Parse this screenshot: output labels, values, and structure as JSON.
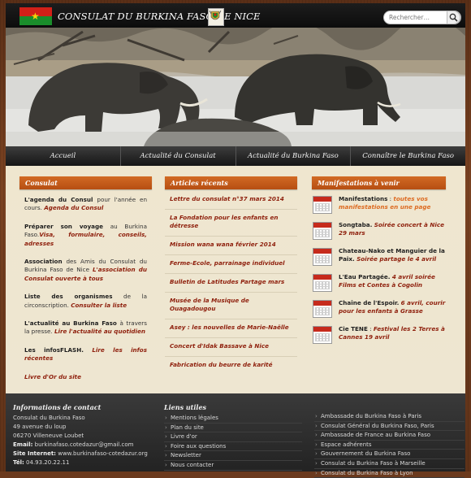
{
  "header": {
    "title": "Consulat du Burkina Faso de Nice",
    "search_placeholder": "Rechercher…"
  },
  "nav": {
    "items": [
      {
        "label": "Accueil"
      },
      {
        "label": "Actualité du Consulat"
      },
      {
        "label": "Actualité du Burkina Faso"
      },
      {
        "label": "Connaître le Burkina Faso"
      }
    ]
  },
  "consulat": {
    "title": "Consulat",
    "items": [
      {
        "lead": "L'agenda du Consul",
        "text": " pour l'année en cours. ",
        "link": "Agenda du Consul"
      },
      {
        "lead": "Préparer son voyage",
        "text": " au Burkina Faso.",
        "link": "Visa, formulaire, conseils, adresses"
      },
      {
        "lead": "Association",
        "text": " des Amis du Consulat du Burkina Faso de Nice ",
        "link": "L'association du Consulat ouverte à tous"
      },
      {
        "lead": "Liste des organismes",
        "text": " de la circonscription. ",
        "link": "Consulter la liste"
      },
      {
        "lead": "L'actualité au Burkina Faso",
        "text": " à travers la presse. ",
        "link": "Lire l'actualité au quotidien"
      },
      {
        "lead": "",
        "text": "Les infosFLASH. ",
        "link": "Lire les infos récentes"
      },
      {
        "lead": "",
        "text": "",
        "link": "Livre d'Or du site"
      }
    ]
  },
  "articles": {
    "title": "Articles récents",
    "items": [
      "Lettre du consulat n°37 mars 2014",
      "La Fondation pour les enfants en détresse",
      "Mission wana wana février 2014",
      "Ferme-Ecole, parrainage individuel",
      "Bulletin de Latitudes Partage mars",
      "Musée de la Musique de Ouagadougou",
      "Asey : les nouvelles de Marie-Naëlle",
      "Concert d'Idak Bassave à Nice",
      "Fabrication du beurre de karité"
    ]
  },
  "manifestations": {
    "title": "Manifestations à venir",
    "items": [
      {
        "lead": "Manifestations",
        "sep": " : ",
        "link": "toutes vos manifestations en une page",
        "orange": true
      },
      {
        "lead": "Songtaba.",
        "sep": " ",
        "link": "Soirée concert à Nice 29 mars",
        "orange": false
      },
      {
        "lead": "Chateau-Nako et Manguier de la Paix.",
        "sep": " ",
        "link": "Soirée partage le 4 avril",
        "orange": false
      },
      {
        "lead": "L'Eau Partagée.",
        "sep": " ",
        "link": "4 avril soirée Films et Contes à Cogolin",
        "orange": false
      },
      {
        "lead": "Chaîne de l'Espoir.",
        "sep": " ",
        "link": "6 avril, courir pour les enfants à Grasse",
        "orange": false
      },
      {
        "lead": "Cie TENE",
        "sep": " : ",
        "link": "Festival les 2 Terres à Cannes 19 avril",
        "orange": false
      }
    ]
  },
  "footer": {
    "contact_title": "Informations de contact",
    "contact": {
      "name": "Consulat du Burkina Faso",
      "address1": "49 avenue du loup",
      "address2": "06270 Villeneuve Loubet",
      "email_label": "Email:",
      "email": "burkinafaso.cotedazur@gmail.com",
      "site_label": "Site Internet:",
      "site": "www.burkinafaso-cotedazur.org",
      "tel_label": "Tél:",
      "tel": "04.93.20.22.11"
    },
    "links_title": "Liens utiles",
    "links": [
      "Mentions légales",
      "Plan du site",
      "Livre d'or",
      "Foire aux questions",
      "Newsletter",
      "Nous contacter"
    ],
    "external": [
      "Ambassade du Burkina Faso à Paris",
      "Consulat Général du Burkina Faso, Paris",
      "Ambassade de France au Burkina Faso",
      "Espace adhérents",
      "Gouvernement du Burkina Faso",
      "Consulat du Burkina Faso à Marseille",
      "Consulat du Burkina Faso à Lyon"
    ]
  }
}
